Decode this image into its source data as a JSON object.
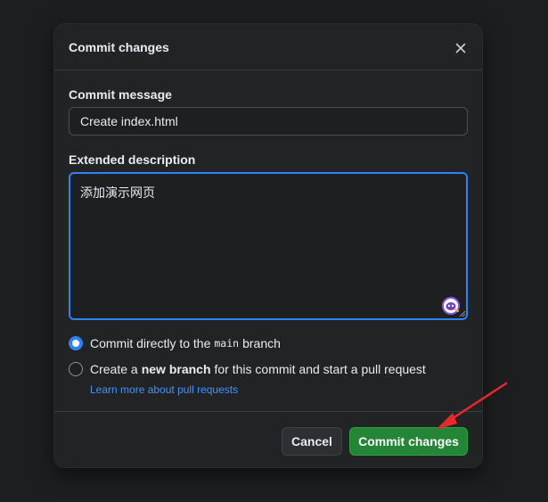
{
  "dialog": {
    "title": "Commit changes",
    "close_icon": "close-icon"
  },
  "commit_message": {
    "label": "Commit message",
    "value": "Create index.html"
  },
  "extended_description": {
    "label": "Extended description",
    "value": "添加演示网页",
    "assistant_icon": "copilot-assistant-icon"
  },
  "branch_options": {
    "direct": {
      "prefix": "Commit directly to the",
      "branch": "main",
      "suffix": "branch",
      "selected": true
    },
    "new_branch": {
      "prefix": "Create a",
      "bold": "new branch",
      "suffix": "for this commit and start a pull request",
      "selected": false
    },
    "learn_more": "Learn more about pull requests"
  },
  "footer": {
    "cancel_label": "Cancel",
    "commit_label": "Commit changes"
  },
  "colors": {
    "accent": "#2f81f7",
    "primary_button": "#238636",
    "link": "#4493f8",
    "annotation_arrow": "#e8282b"
  }
}
